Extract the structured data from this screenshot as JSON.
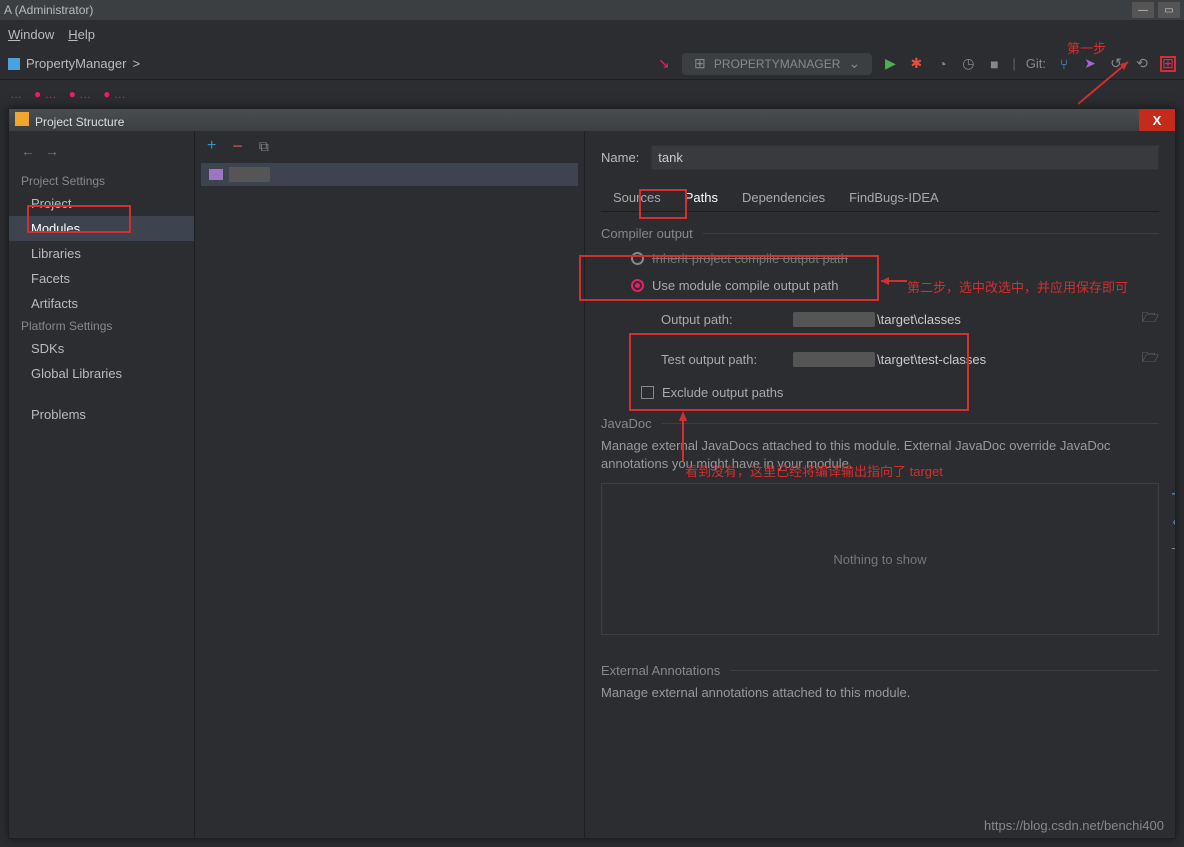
{
  "os": {
    "title": "A (Administrator)"
  },
  "menu": {
    "window": "Window",
    "help": "Help"
  },
  "breadcrumb": {
    "project": "PropertyManager",
    "sep": ">"
  },
  "runconfig": {
    "label": "PROPERTYMANAGER"
  },
  "git": {
    "label": "Git:"
  },
  "annotations": {
    "step1": "第一步",
    "step2": "第二步，选中改选中，并应用保存即可",
    "step3": "看到没有，这里已经将编译输出指向了 target"
  },
  "dialog": {
    "title": "Project Structure",
    "close": "X",
    "sidebar": {
      "sec1": "Project Settings",
      "items1": [
        "Project",
        "Modules",
        "Libraries",
        "Facets",
        "Artifacts"
      ],
      "sec2": "Platform Settings",
      "items2": [
        "SDKs",
        "Global Libraries"
      ],
      "sec3": "Problems"
    },
    "nameLabel": "Name:",
    "nameValue": "tank",
    "tabs": [
      "Sources",
      "Paths",
      "Dependencies",
      "FindBugs-IDEA"
    ],
    "compilerOutput": "Compiler output",
    "radioInherit": "Inherit project compile output path",
    "radioUse": "Use module compile output path",
    "outputPath": {
      "label": "Output path:",
      "suffix": "\\target\\classes"
    },
    "testOutputPath": {
      "label": "Test output path:",
      "suffix": "\\target\\test-classes"
    },
    "exclude": "Exclude output paths",
    "javadoc": {
      "title": "JavaDoc",
      "desc": "Manage external JavaDocs attached to this module. External JavaDoc override JavaDoc annotations you might have in your module.",
      "empty": "Nothing to show"
    },
    "extAnn": {
      "title": "External Annotations",
      "desc": "Manage external annotations attached to this module."
    }
  },
  "watermark": "https://blog.csdn.net/benchi400"
}
